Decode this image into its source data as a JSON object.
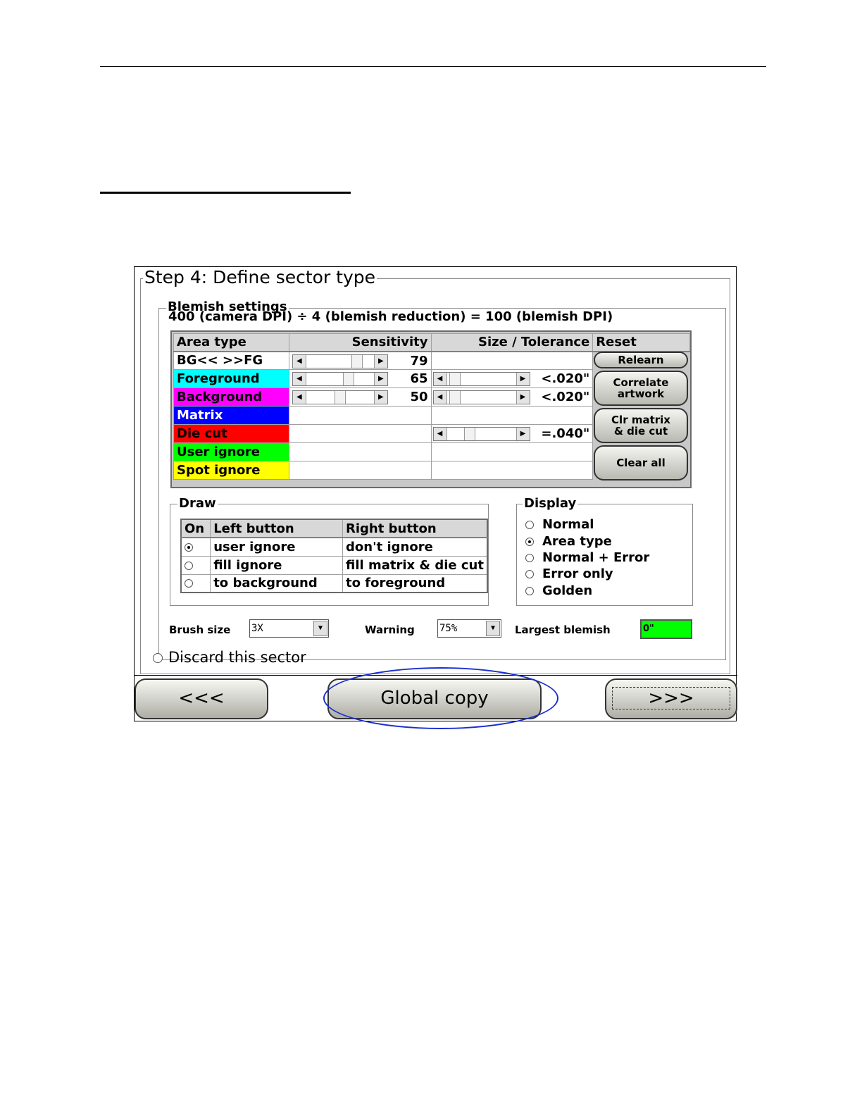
{
  "window": {
    "step_title": "Step 4: Define sector type",
    "blemish_settings": {
      "legend": "Blemish settings",
      "dpi_formula": "400 (camera DPI) ÷ 4 (blemish reduction) = 100 (blemish DPI)",
      "headers": {
        "area_type": "Area type",
        "sensitivity": "Sensitivity",
        "size_tolerance": "Size / Tolerance",
        "reset": "Reset"
      },
      "rows": [
        {
          "label": "BG<< >>FG",
          "sensitivity": "79",
          "sensitivity_level": 0.79,
          "tolerance": ""
        },
        {
          "label": "Foreground",
          "sensitivity": "65",
          "sensitivity_level": 0.65,
          "tolerance": "<.020\"",
          "tolerance_level": 0.05,
          "color": "#00ffff"
        },
        {
          "label": "Background",
          "sensitivity": "50",
          "sensitivity_level": 0.5,
          "tolerance": "<.020\"",
          "tolerance_level": 0.05,
          "color": "#ff00ff"
        },
        {
          "label": "Matrix",
          "color": "#0000ff"
        },
        {
          "label": "Die cut",
          "tolerance": "=.040\"",
          "tolerance_level": 0.3,
          "color": "#ff0000"
        },
        {
          "label": "User ignore",
          "color": "#00ff00"
        },
        {
          "label": "Spot ignore",
          "color": "#ffff00"
        }
      ],
      "reset_buttons": {
        "relearn": "Relearn",
        "correlate_1": "Correlate",
        "correlate_2": "artwork",
        "clr_1": "Clr matrix",
        "clr_2": "& die cut",
        "clear_all": "Clear all"
      }
    },
    "draw": {
      "legend": "Draw",
      "headers": {
        "on": "On",
        "left": "Left button",
        "right": "Right button"
      },
      "rows": [
        {
          "left": "user ignore",
          "right": "don't ignore",
          "selected": true
        },
        {
          "left": "fill ignore",
          "right": "fill matrix & die cut",
          "selected": false
        },
        {
          "left": "to background",
          "right": "to foreground",
          "selected": false
        }
      ]
    },
    "display": {
      "legend": "Display",
      "options": [
        "Normal",
        "Area type",
        "Normal + Error",
        "Error only",
        "Golden"
      ],
      "selected": "Area type"
    },
    "bottom": {
      "brush_size_label": "Brush size",
      "brush_size_value": "3X",
      "warning_label": "Warning",
      "warning_value": "75%",
      "largest_blemish_label": "Largest blemish",
      "largest_blemish_value": "0\"",
      "largest_blemish_color": "#00ff00"
    },
    "discard_label": "Discard this sector",
    "nav": {
      "back": "<<<",
      "global_copy": "Global copy",
      "next": ">>>"
    },
    "highlight_color": "#1a2fd0"
  }
}
